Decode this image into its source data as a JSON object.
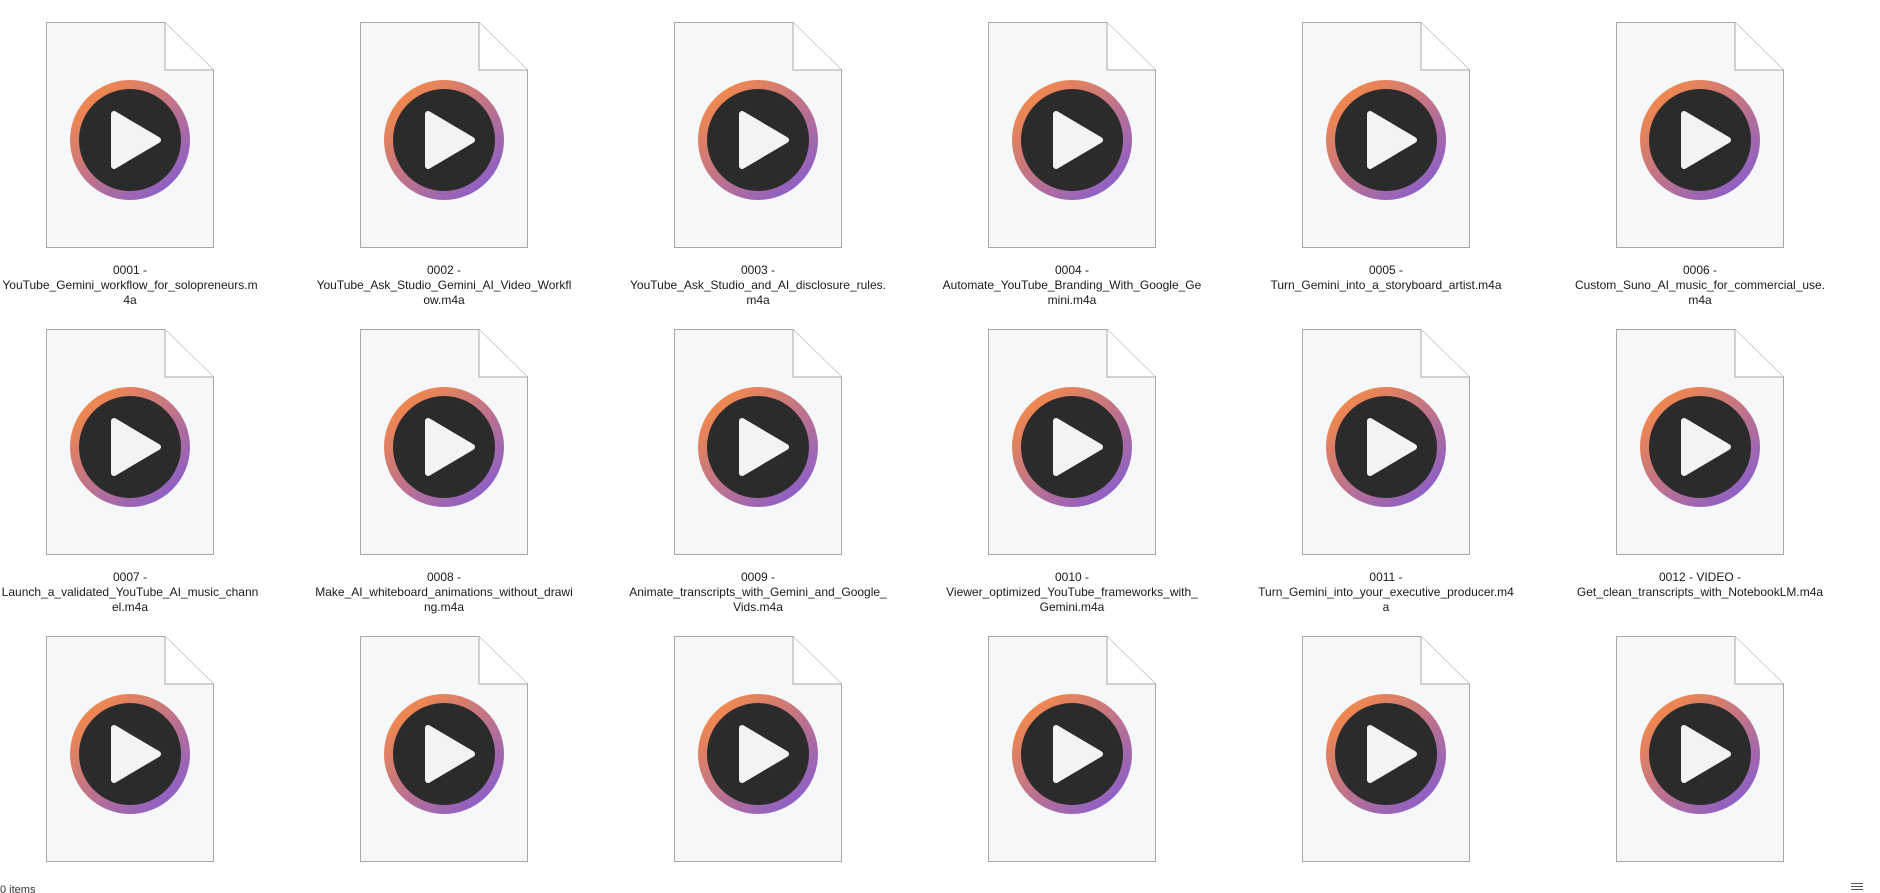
{
  "files": [
    {
      "number": "0001 -",
      "name": "YouTube_Gemini_workflow_for_solopreneurs.m4a"
    },
    {
      "number": "0002 -",
      "name": "YouTube_Ask_Studio_Gemini_AI_Video_Workflow.m4a"
    },
    {
      "number": "0003 -",
      "name": "YouTube_Ask_Studio_and_AI_disclosure_rules.m4a"
    },
    {
      "number": "0004 -",
      "name": "Automate_YouTube_Branding_With_Google_Gemini.m4a"
    },
    {
      "number": "0005 -",
      "name": "Turn_Gemini_into_a_storyboard_artist.m4a"
    },
    {
      "number": "0006 -",
      "name": "Custom_Suno_AI_music_for_commercial_use.m4a"
    },
    {
      "number": "0007 -",
      "name": "Launch_a_validated_YouTube_AI_music_channel.m4a"
    },
    {
      "number": "0008 -",
      "name": "Make_AI_whiteboard_animations_without_drawing.m4a"
    },
    {
      "number": "0009 -",
      "name": "Animate_transcripts_with_Gemini_and_Google_Vids.m4a"
    },
    {
      "number": "0010 -",
      "name": "Viewer_optimized_YouTube_frameworks_with_Gemini.m4a"
    },
    {
      "number": "0011 -",
      "name": "Turn_Gemini_into_your_executive_producer.m4a"
    },
    {
      "number": "0012 - VIDEO -",
      "name": "Get_clean_transcripts_with_NotebookLM.m4a"
    },
    {
      "number": "",
      "name": ""
    },
    {
      "number": "",
      "name": ""
    },
    {
      "number": "",
      "name": ""
    },
    {
      "number": "",
      "name": ""
    },
    {
      "number": "",
      "name": ""
    },
    {
      "number": "",
      "name": ""
    }
  ],
  "file_icon": "media-audio-file-icon",
  "colors": {
    "ring_orange": "#f4894a",
    "ring_purple": "#8c5fc8",
    "disc": "#2b2b2b",
    "play": "#f3f3f3",
    "page": "#f6f7f9",
    "page_border": "#a8a8a8"
  },
  "status": {
    "item_count": "0 items"
  }
}
